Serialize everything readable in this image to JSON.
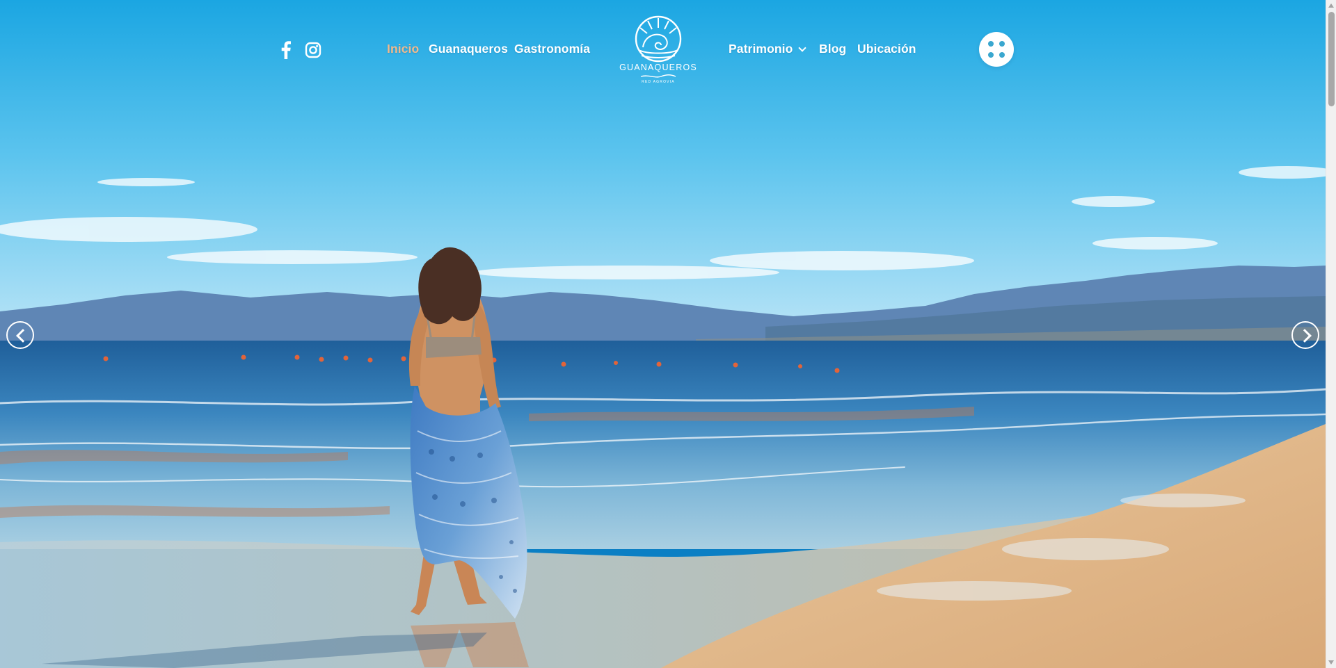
{
  "site": {
    "brand": "GUANAQUEROS",
    "brand_tagline": "RED AGROVIA",
    "accent_color": "#f0b98c",
    "menu_dot_color": "#3aa7cf"
  },
  "social": [
    {
      "name": "facebook",
      "icon": "facebook-icon"
    },
    {
      "name": "instagram",
      "icon": "instagram-icon"
    }
  ],
  "nav": {
    "left": [
      {
        "label": "Inicio",
        "active": true
      },
      {
        "label": "Guanaqueros",
        "active": false
      },
      {
        "label": "Gastronomía",
        "active": false
      }
    ],
    "right": [
      {
        "label": "Patrimonio",
        "has_dropdown": true
      },
      {
        "label": "Blog",
        "has_dropdown": false
      },
      {
        "label": "Ubicación",
        "has_dropdown": false
      }
    ]
  },
  "menu_button": {
    "icon": "four-dots-menu-icon"
  },
  "slider": {
    "prev_icon": "chevron-left-circle-icon",
    "next_icon": "chevron-right-circle-icon"
  }
}
